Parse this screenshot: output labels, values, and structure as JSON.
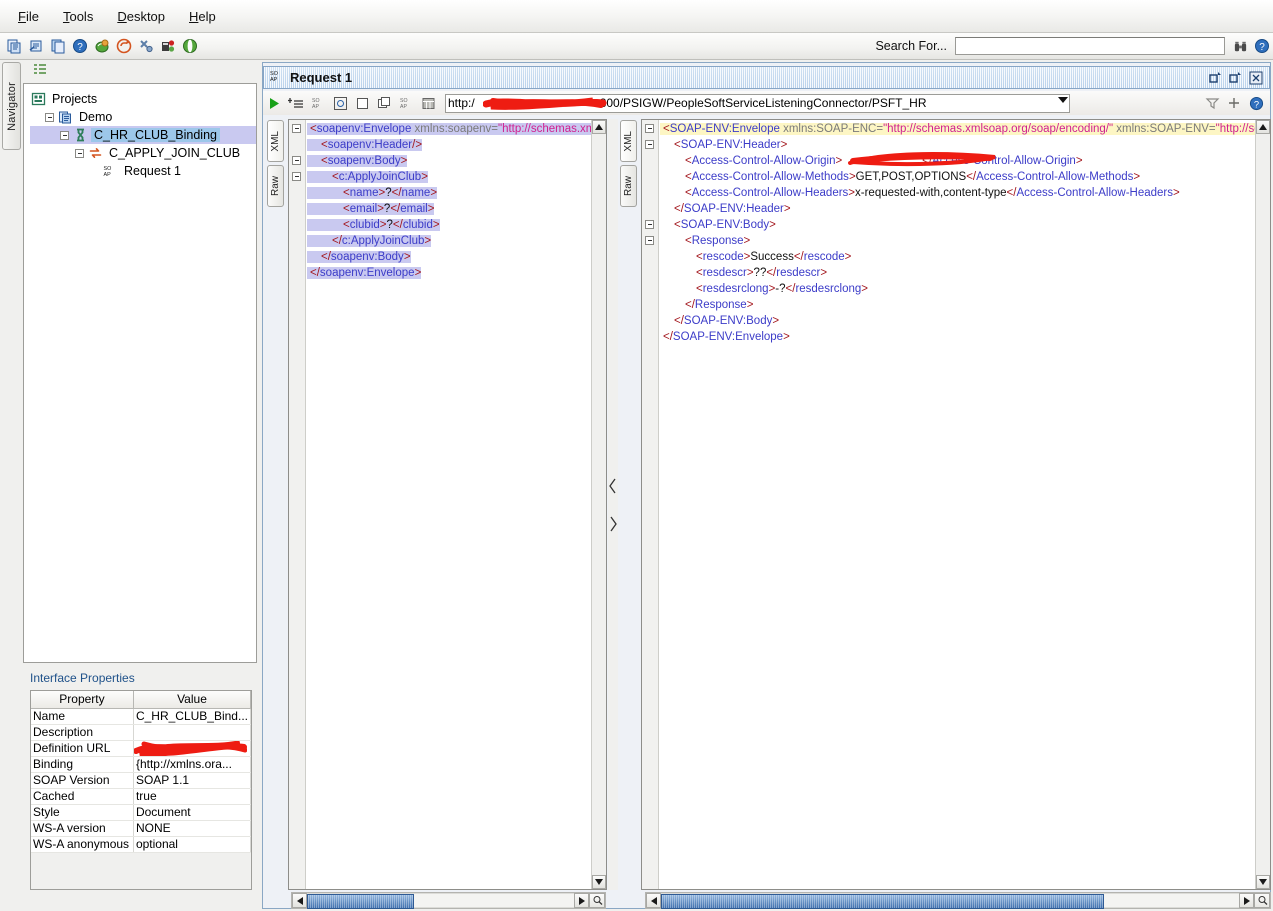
{
  "menu": {
    "items": [
      {
        "label": "File",
        "mnemonic": "F"
      },
      {
        "label": "Tools",
        "mnemonic": "T"
      },
      {
        "label": "Desktop",
        "mnemonic": "D"
      },
      {
        "label": "Help",
        "mnemonic": "H"
      }
    ]
  },
  "toolbar": {
    "icons": [
      "new-workspace-icon",
      "import-project-icon",
      "save-all-icon",
      "help-icon",
      "new-soap-project-icon",
      "new-rest-project-icon",
      "preferences-icon",
      "load-test-icon",
      "security-test-icon"
    ],
    "search_label": "Search For...",
    "search_value": "",
    "search_placeholder": "",
    "search_go_icon": "binoculars-icon",
    "search_help_icon": "help-icon"
  },
  "navigator": {
    "tab_label": "Navigator",
    "header_icon": "collapse-all-icon",
    "tree": [
      {
        "label": "Projects",
        "icon": "projects-icon",
        "depth": 0,
        "toggle": false,
        "selected": false
      },
      {
        "label": "Demo",
        "icon": "project-icon",
        "depth": 1,
        "toggle": true,
        "selected": false
      },
      {
        "label": "C_HR_CLUB_Binding",
        "icon": "interface-icon",
        "depth": 2,
        "toggle": true,
        "selected": true
      },
      {
        "label": "C_APPLY_JOIN_CLUB",
        "icon": "operation-icon",
        "depth": 3,
        "toggle": true,
        "selected": false
      },
      {
        "label": "Request 1",
        "icon": "soap-request-icon",
        "depth": 4,
        "toggle": false,
        "selected": false
      }
    ]
  },
  "interface_properties": {
    "title": "Interface Properties",
    "columns": [
      "Property",
      "Value"
    ],
    "rows": [
      {
        "property": "Name",
        "value": "C_HR_CLUB_Bind...",
        "redacted": false
      },
      {
        "property": "Description",
        "value": "",
        "redacted": false
      },
      {
        "property": "Definition URL",
        "value": "",
        "redacted": true
      },
      {
        "property": "Binding",
        "value": "{http://xmlns.ora...",
        "redacted": false
      },
      {
        "property": "SOAP Version",
        "value": "SOAP 1.1",
        "redacted": false
      },
      {
        "property": "Cached",
        "value": "true",
        "redacted": false
      },
      {
        "property": "Style",
        "value": "Document",
        "redacted": false
      },
      {
        "property": "WS-A version",
        "value": "NONE",
        "redacted": false
      },
      {
        "property": "WS-A anonymous",
        "value": "optional",
        "redacted": false
      }
    ]
  },
  "request_window": {
    "title": "Request 1",
    "title_icon": "soap-request-icon",
    "window_buttons": [
      "restore-icon",
      "maximize-icon",
      "close-icon"
    ],
    "toolbar_icons": [
      "run-icon",
      "add-assertion-icon",
      "soap-wsa-icon",
      "recreate-request-icon",
      "one-way-icon",
      "clone-request-icon",
      "soap-wss-icon",
      "form-view-icon"
    ],
    "url_prefix": "http:/",
    "url_suffix": "800/PSIGW/PeopleSoftServiceListeningConnector/PSFT_HR",
    "url_redacted": true,
    "endpoint_dropdown_icon": "chevron-down-icon",
    "right_icons": [
      "filter-icon",
      "add-endpoint-icon",
      "help-icon"
    ]
  },
  "request_pane": {
    "vtabs": [
      {
        "label": "XML",
        "active": true
      },
      {
        "label": "Raw",
        "active": false
      }
    ],
    "lines": [
      {
        "indent": 0,
        "fold": true,
        "sel": true,
        "parts": [
          {
            "t": "tag",
            "v": "<"
          },
          {
            "t": "tagname",
            "v": "soapenv:Envelope"
          },
          {
            "t": "attr",
            "v": " xmlns:soapenv="
          },
          {
            "t": "attrval",
            "v": "\"http://schemas.xmlso"
          }
        ]
      },
      {
        "indent": 1,
        "fold": false,
        "sel": true,
        "parts": [
          {
            "t": "tag",
            "v": "<"
          },
          {
            "t": "tagname",
            "v": "soapenv:Header"
          },
          {
            "t": "tag",
            "v": "/>"
          }
        ]
      },
      {
        "indent": 1,
        "fold": true,
        "sel": true,
        "parts": [
          {
            "t": "tag",
            "v": "<"
          },
          {
            "t": "tagname",
            "v": "soapenv:Body"
          },
          {
            "t": "tag",
            "v": ">"
          }
        ]
      },
      {
        "indent": 2,
        "fold": true,
        "sel": true,
        "parts": [
          {
            "t": "tag",
            "v": "<"
          },
          {
            "t": "tagname",
            "v": "c:ApplyJoinClub"
          },
          {
            "t": "tag",
            "v": ">"
          }
        ]
      },
      {
        "indent": 3,
        "fold": false,
        "sel": true,
        "parts": [
          {
            "t": "tag",
            "v": "<"
          },
          {
            "t": "tagname",
            "v": "name"
          },
          {
            "t": "tag",
            "v": ">"
          },
          {
            "t": "txt",
            "v": "?"
          },
          {
            "t": "tag",
            "v": "</"
          },
          {
            "t": "tagname",
            "v": "name"
          },
          {
            "t": "tag",
            "v": ">"
          }
        ]
      },
      {
        "indent": 3,
        "fold": false,
        "sel": true,
        "parts": [
          {
            "t": "tag",
            "v": "<"
          },
          {
            "t": "tagname",
            "v": "email"
          },
          {
            "t": "tag",
            "v": ">"
          },
          {
            "t": "txt",
            "v": "?"
          },
          {
            "t": "tag",
            "v": "</"
          },
          {
            "t": "tagname",
            "v": "email"
          },
          {
            "t": "tag",
            "v": ">"
          }
        ]
      },
      {
        "indent": 3,
        "fold": false,
        "sel": true,
        "parts": [
          {
            "t": "tag",
            "v": "<"
          },
          {
            "t": "tagname",
            "v": "clubid"
          },
          {
            "t": "tag",
            "v": ">"
          },
          {
            "t": "txt",
            "v": "?"
          },
          {
            "t": "tag",
            "v": "</"
          },
          {
            "t": "tagname",
            "v": "clubid"
          },
          {
            "t": "tag",
            "v": ">"
          }
        ]
      },
      {
        "indent": 2,
        "fold": false,
        "sel": true,
        "parts": [
          {
            "t": "tag",
            "v": "</"
          },
          {
            "t": "tagname",
            "v": "c:ApplyJoinClub"
          },
          {
            "t": "tag",
            "v": ">"
          }
        ]
      },
      {
        "indent": 1,
        "fold": false,
        "sel": true,
        "parts": [
          {
            "t": "tag",
            "v": "</"
          },
          {
            "t": "tagname",
            "v": "soapenv:Body"
          },
          {
            "t": "tag",
            "v": ">"
          }
        ]
      },
      {
        "indent": 0,
        "fold": false,
        "sel": true,
        "parts": [
          {
            "t": "tag",
            "v": "</"
          },
          {
            "t": "tagname",
            "v": "soapenv:Envelope"
          },
          {
            "t": "tag",
            "v": ">"
          }
        ]
      }
    ]
  },
  "response_pane": {
    "vtabs": [
      {
        "label": "XML",
        "active": true
      },
      {
        "label": "Raw",
        "active": false
      }
    ],
    "lines": [
      {
        "indent": 0,
        "fold": true,
        "hl": true,
        "parts": [
          {
            "t": "tag",
            "v": "<"
          },
          {
            "t": "tagname",
            "v": "SOAP-ENV:Envelope"
          },
          {
            "t": "attr",
            "v": " xmlns:SOAP-ENC="
          },
          {
            "t": "attrval",
            "v": "\"http://schemas.xmlsoap.org/soap/encoding/\""
          },
          {
            "t": "attr",
            "v": " xmlns:SOAP-ENV="
          },
          {
            "t": "attrval",
            "v": "\"http://schemas.x"
          }
        ]
      },
      {
        "indent": 1,
        "fold": true,
        "hl": false,
        "parts": [
          {
            "t": "tag",
            "v": "<"
          },
          {
            "t": "tagname",
            "v": "SOAP-ENV:Header"
          },
          {
            "t": "tag",
            "v": ">"
          }
        ]
      },
      {
        "indent": 2,
        "fold": false,
        "hl": false,
        "redacted": true,
        "parts": [
          {
            "t": "tag",
            "v": "<"
          },
          {
            "t": "tagname",
            "v": "Access-Control-Allow-Origin"
          },
          {
            "t": "tag",
            "v": ">"
          },
          {
            "t": "txt",
            "v": "                         "
          },
          {
            "t": "tag",
            "v": "</"
          },
          {
            "t": "tagname",
            "v": "Access-Control-Allow-Origin"
          },
          {
            "t": "tag",
            "v": ">"
          }
        ]
      },
      {
        "indent": 2,
        "fold": false,
        "hl": false,
        "parts": [
          {
            "t": "tag",
            "v": "<"
          },
          {
            "t": "tagname",
            "v": "Access-Control-Allow-Methods"
          },
          {
            "t": "tag",
            "v": ">"
          },
          {
            "t": "txt",
            "v": "GET,POST,OPTIONS"
          },
          {
            "t": "tag",
            "v": "</"
          },
          {
            "t": "tagname",
            "v": "Access-Control-Allow-Methods"
          },
          {
            "t": "tag",
            "v": ">"
          }
        ]
      },
      {
        "indent": 2,
        "fold": false,
        "hl": false,
        "parts": [
          {
            "t": "tag",
            "v": "<"
          },
          {
            "t": "tagname",
            "v": "Access-Control-Allow-Headers"
          },
          {
            "t": "tag",
            "v": ">"
          },
          {
            "t": "txt",
            "v": "x-requested-with,content-type"
          },
          {
            "t": "tag",
            "v": "</"
          },
          {
            "t": "tagname",
            "v": "Access-Control-Allow-Headers"
          },
          {
            "t": "tag",
            "v": ">"
          }
        ]
      },
      {
        "indent": 1,
        "fold": false,
        "hl": false,
        "parts": [
          {
            "t": "tag",
            "v": "</"
          },
          {
            "t": "tagname",
            "v": "SOAP-ENV:Header"
          },
          {
            "t": "tag",
            "v": ">"
          }
        ]
      },
      {
        "indent": 1,
        "fold": true,
        "hl": false,
        "parts": [
          {
            "t": "tag",
            "v": "<"
          },
          {
            "t": "tagname",
            "v": "SOAP-ENV:Body"
          },
          {
            "t": "tag",
            "v": ">"
          }
        ]
      },
      {
        "indent": 2,
        "fold": true,
        "hl": false,
        "parts": [
          {
            "t": "tag",
            "v": "<"
          },
          {
            "t": "tagname",
            "v": "Response"
          },
          {
            "t": "tag",
            "v": ">"
          }
        ]
      },
      {
        "indent": 3,
        "fold": false,
        "hl": false,
        "parts": [
          {
            "t": "tag",
            "v": "<"
          },
          {
            "t": "tagname",
            "v": "rescode"
          },
          {
            "t": "tag",
            "v": ">"
          },
          {
            "t": "txt",
            "v": "Success"
          },
          {
            "t": "tag",
            "v": "</"
          },
          {
            "t": "tagname",
            "v": "rescode"
          },
          {
            "t": "tag",
            "v": ">"
          }
        ]
      },
      {
        "indent": 3,
        "fold": false,
        "hl": false,
        "parts": [
          {
            "t": "tag",
            "v": "<"
          },
          {
            "t": "tagname",
            "v": "resdescr"
          },
          {
            "t": "tag",
            "v": ">"
          },
          {
            "t": "txt",
            "v": "??"
          },
          {
            "t": "tag",
            "v": "</"
          },
          {
            "t": "tagname",
            "v": "resdescr"
          },
          {
            "t": "tag",
            "v": ">"
          }
        ]
      },
      {
        "indent": 3,
        "fold": false,
        "hl": false,
        "parts": [
          {
            "t": "tag",
            "v": "<"
          },
          {
            "t": "tagname",
            "v": "resdesrclong"
          },
          {
            "t": "tag",
            "v": ">"
          },
          {
            "t": "txt",
            "v": "-?"
          },
          {
            "t": "tag",
            "v": "</"
          },
          {
            "t": "tagname",
            "v": "resdesrclong"
          },
          {
            "t": "tag",
            "v": ">"
          }
        ]
      },
      {
        "indent": 2,
        "fold": false,
        "hl": false,
        "parts": [
          {
            "t": "tag",
            "v": "</"
          },
          {
            "t": "tagname",
            "v": "Response"
          },
          {
            "t": "tag",
            "v": ">"
          }
        ]
      },
      {
        "indent": 1,
        "fold": false,
        "hl": false,
        "parts": [
          {
            "t": "tag",
            "v": "</"
          },
          {
            "t": "tagname",
            "v": "SOAP-ENV:Body"
          },
          {
            "t": "tag",
            "v": ">"
          }
        ]
      },
      {
        "indent": 0,
        "fold": false,
        "hl": false,
        "parts": [
          {
            "t": "tag",
            "v": "</"
          },
          {
            "t": "tagname",
            "v": "SOAP-ENV:Envelope"
          },
          {
            "t": "tag",
            "v": ">"
          }
        ]
      }
    ]
  },
  "colors": {
    "redaction": "#ee1c12",
    "selection": "#c9c9f0",
    "highlight": "#fdf6c4",
    "tree_selection": "#9cc7ea",
    "title_bar": "#b9d2ec",
    "tag": "#a3171e",
    "tagname": "#3c3cc8",
    "attr_value": "#d02090",
    "link_title": "#20528a"
  }
}
